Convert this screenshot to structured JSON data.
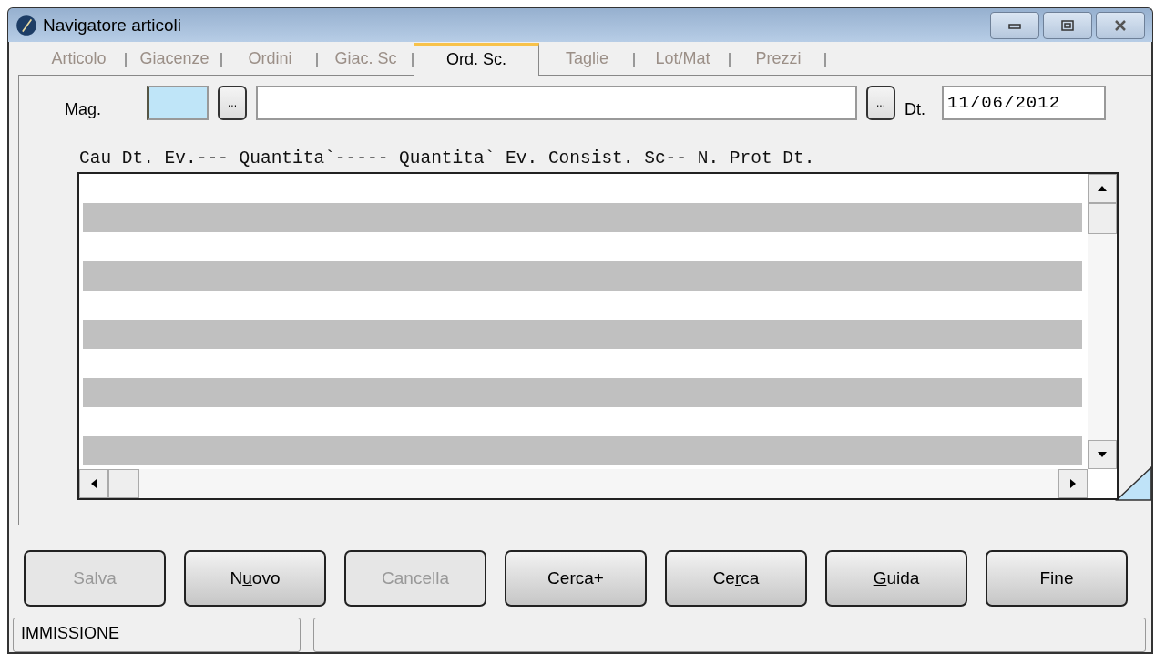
{
  "window": {
    "title": "Navigatore articoli"
  },
  "tabs": [
    {
      "label": "Articolo",
      "selected": false
    },
    {
      "label": "Giacenze",
      "selected": false
    },
    {
      "label": "Ordini",
      "selected": false
    },
    {
      "label": "Giac. Sc",
      "selected": false
    },
    {
      "label": "Ord. Sc.",
      "selected": true
    },
    {
      "label": "Taglie",
      "selected": false
    },
    {
      "label": "Lot/Mat",
      "selected": false
    },
    {
      "label": "Prezzi",
      "selected": false
    }
  ],
  "form": {
    "mag_label": "Mag.",
    "mag_lookup": "...",
    "desc_lookup": "...",
    "date_label": "Dt.",
    "date_value": "11/06/2012"
  },
  "grid": {
    "header": "Cau Dt. Ev.--- Quantita`----- Quantita` Ev. Consist. Sc-- N. Prot Dt."
  },
  "buttons": [
    {
      "before": "Salva",
      "disabled": true
    },
    {
      "before": "N",
      "key": "u",
      "after": "ovo",
      "disabled": false
    },
    {
      "before": "Cancella",
      "disabled": true
    },
    {
      "before": "Cerca+",
      "disabled": false
    },
    {
      "before": "Ce",
      "key": "r",
      "after": "ca",
      "disabled": false
    },
    {
      "key": "G",
      "after": "uida",
      "disabled": false
    },
    {
      "before": "Fine",
      "disabled": false
    }
  ],
  "status_bar": {
    "mode": "IMMISSIONE"
  }
}
